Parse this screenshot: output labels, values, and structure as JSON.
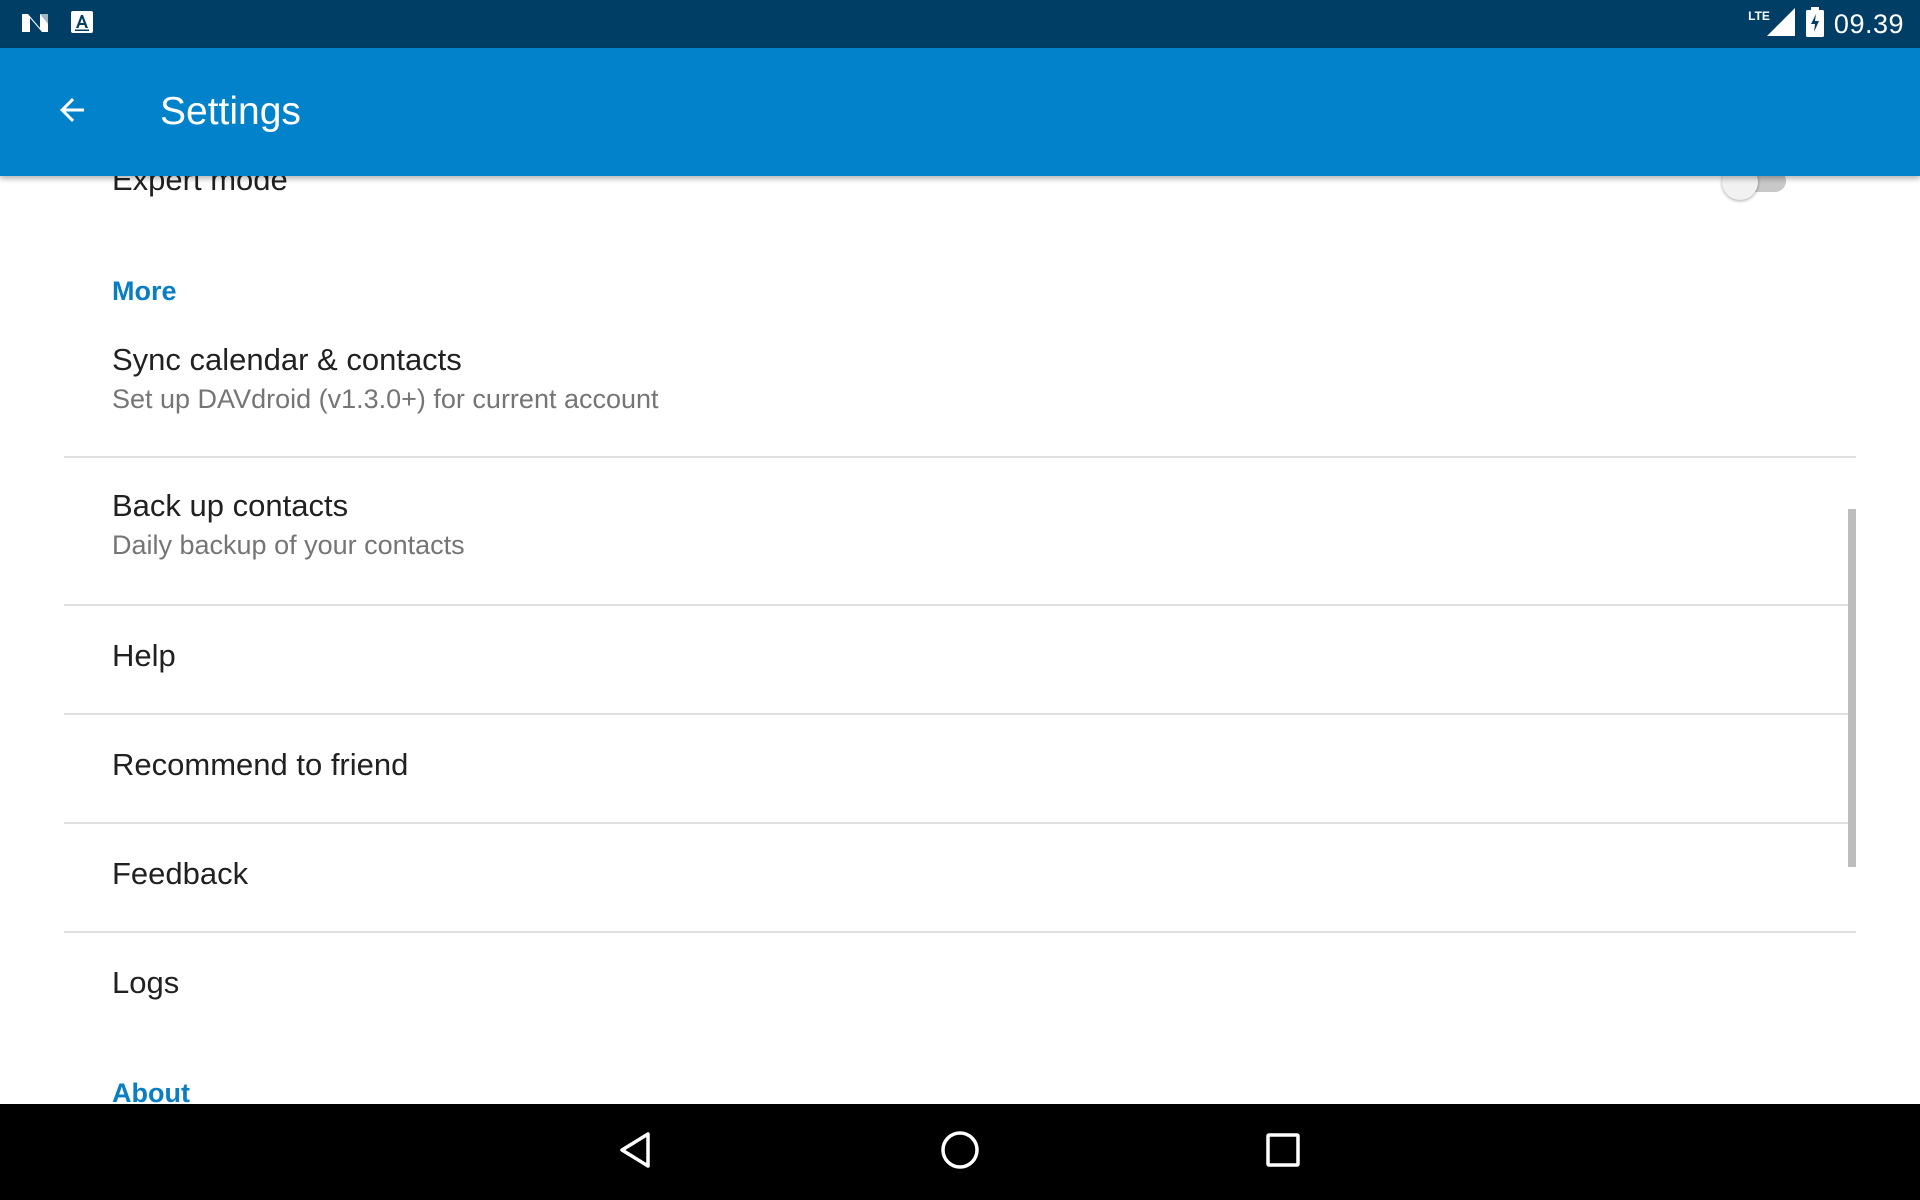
{
  "status_bar": {
    "notification_icons": [
      "n-logo-icon",
      "font-a-icon"
    ],
    "network_label": "LTE",
    "time": "09.39"
  },
  "app_bar": {
    "title": "Settings",
    "back_icon": "arrow-back-icon"
  },
  "settings": {
    "expert_mode": {
      "title": "Expert mode",
      "enabled": false
    },
    "more_header": "More",
    "items": [
      {
        "title": "Sync calendar & contacts",
        "summary": "Set up DAVdroid (v1.3.0+) for current account"
      },
      {
        "title": "Back up contacts",
        "summary": "Daily backup of your contacts"
      },
      {
        "title": "Help"
      },
      {
        "title": "Recommend to friend"
      },
      {
        "title": "Feedback"
      },
      {
        "title": "Logs"
      }
    ],
    "about_header": "About"
  },
  "nav_bar": {
    "back_icon": "nav-back-icon",
    "home_icon": "nav-home-icon",
    "recents_icon": "nav-recents-icon"
  },
  "colors": {
    "status_bar": "#003e65",
    "app_bar": "#0182ca",
    "category_text": "#0a7ec2",
    "primary_text": "#212121",
    "secondary_text": "#757575"
  }
}
